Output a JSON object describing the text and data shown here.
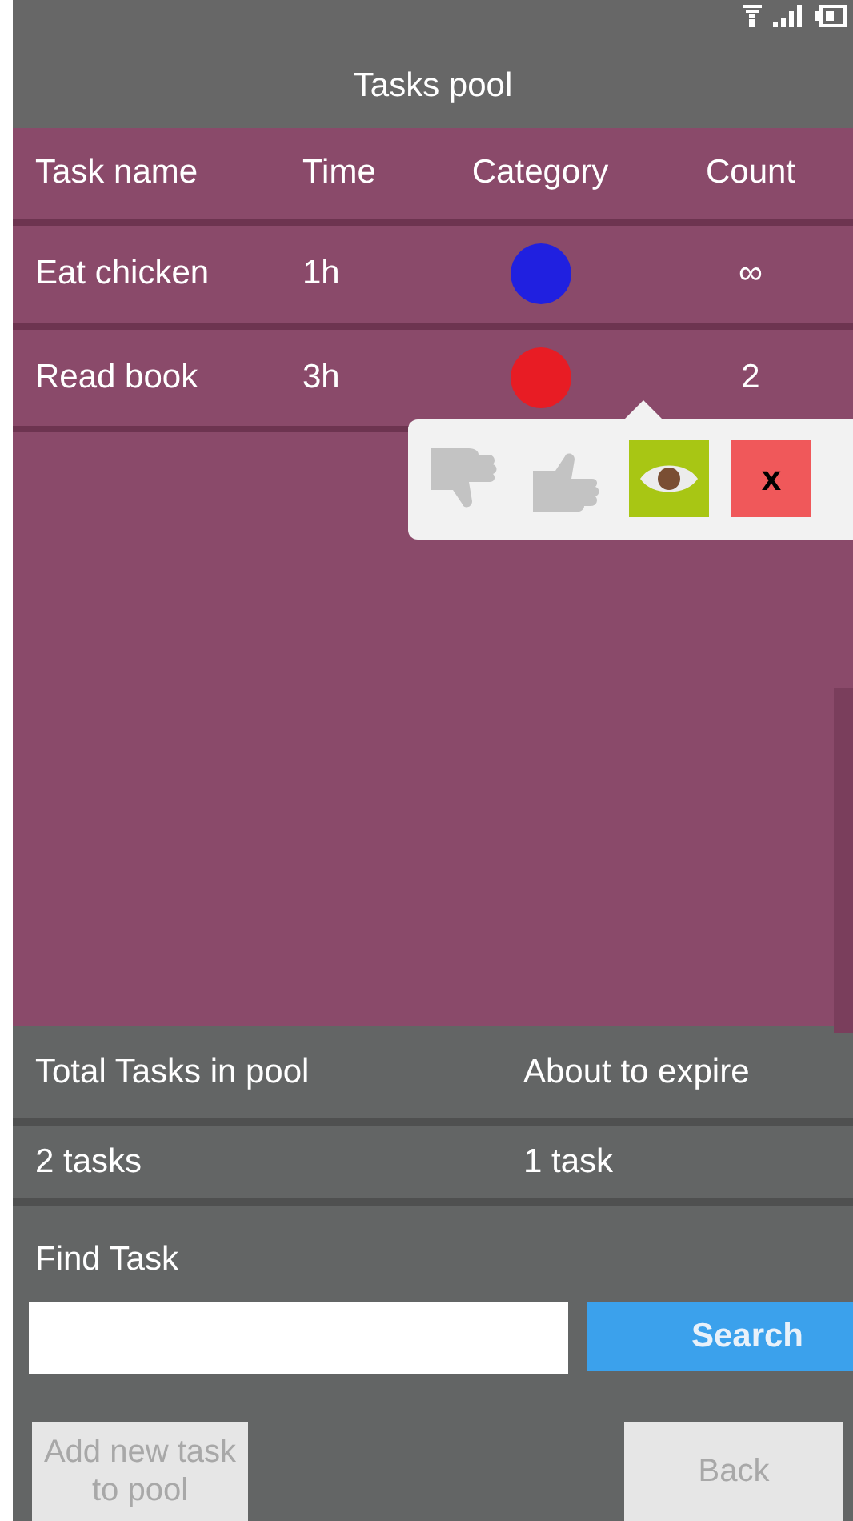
{
  "header": {
    "title": "Tasks pool"
  },
  "table": {
    "columns": [
      "Task name",
      "Time",
      "Category",
      "Count"
    ],
    "rows": [
      {
        "name": "Eat chicken",
        "time": "1h",
        "color": "#2020e0",
        "count": "∞"
      },
      {
        "name": "Read book",
        "time": "3h",
        "color": "#e81c24",
        "count": "2"
      }
    ]
  },
  "row_actions": [
    {
      "kind": "dislike"
    },
    {
      "kind": "like"
    },
    {
      "kind": "view"
    },
    {
      "kind": "delete",
      "label": "x"
    }
  ],
  "stats": {
    "labels": [
      "Total Tasks in pool",
      "About to expire"
    ],
    "values": [
      "2 tasks",
      "1 task"
    ]
  },
  "find": {
    "label": "Find Task",
    "button": "Search"
  },
  "buttons": [
    {
      "label": "Add new task to pool",
      "disabled": true
    },
    {
      "label": "Back",
      "disabled": true
    }
  ]
}
